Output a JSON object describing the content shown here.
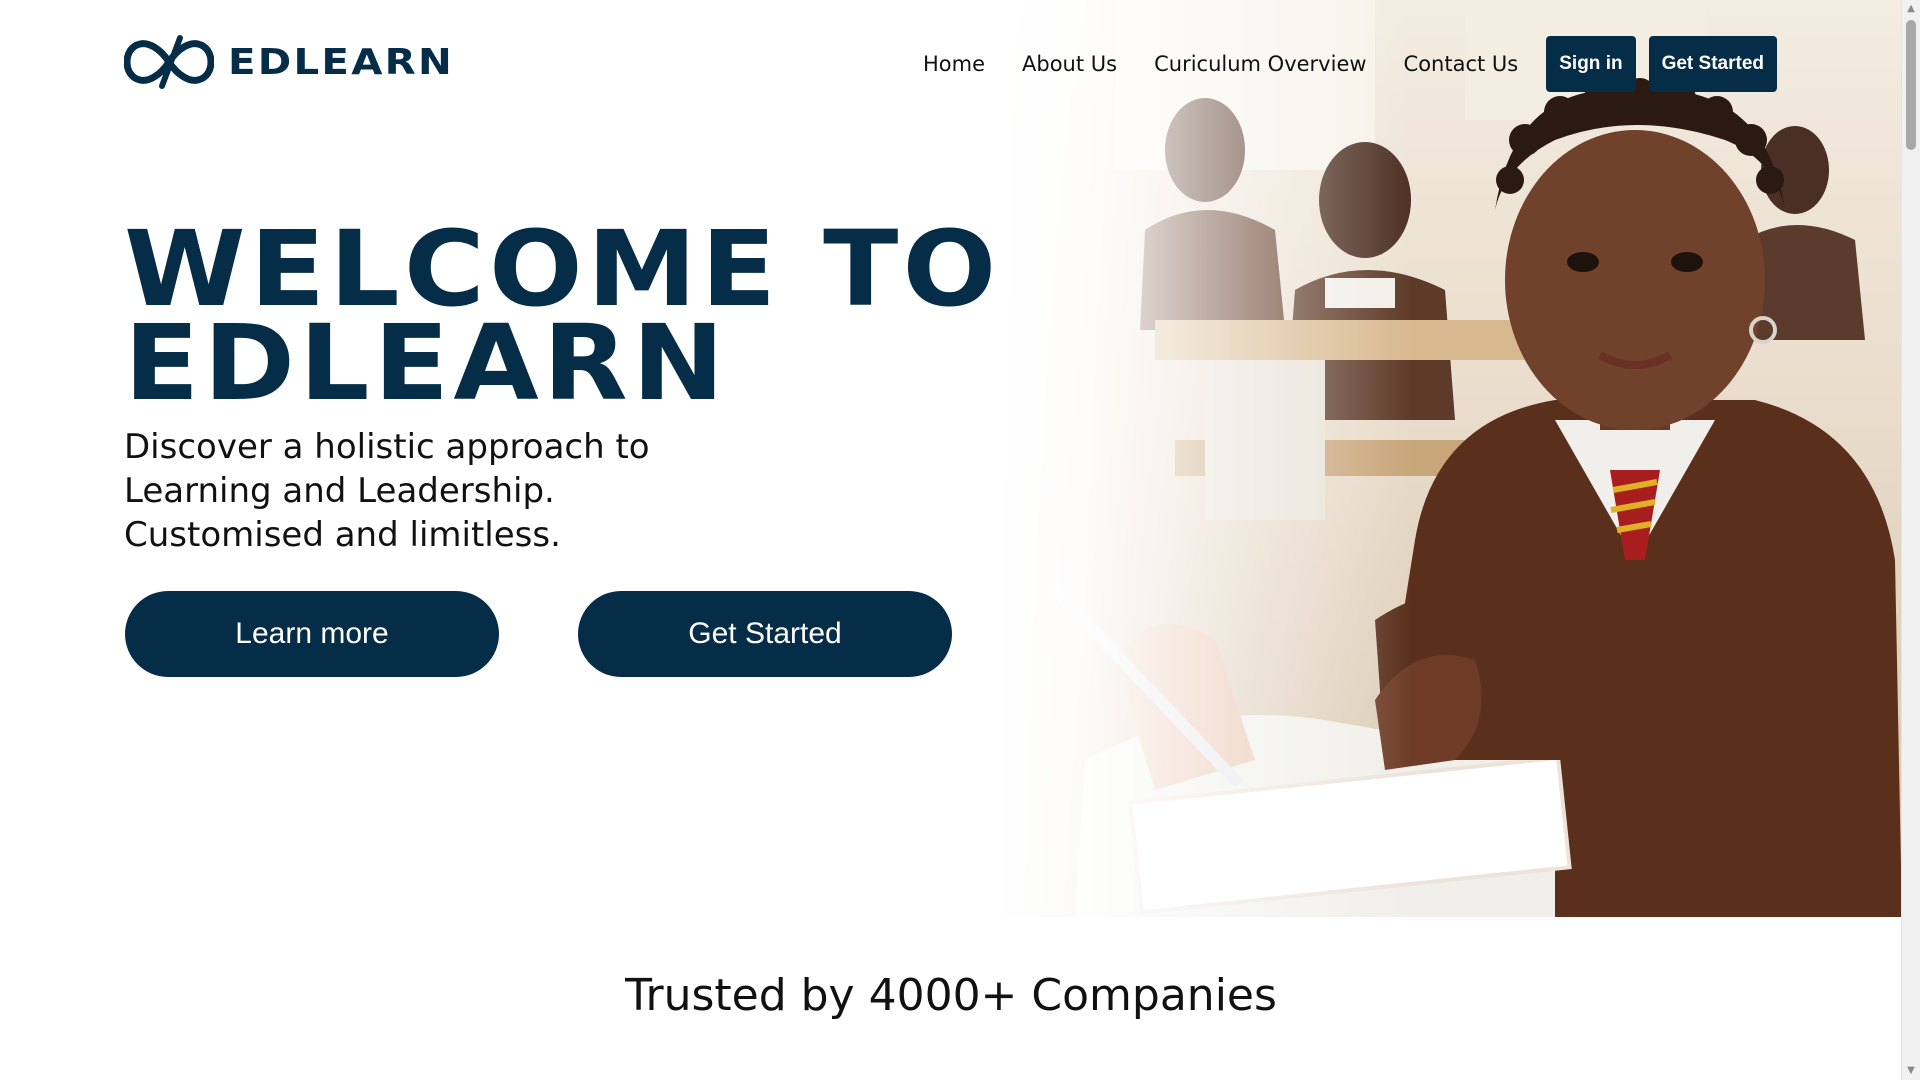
{
  "brand": {
    "name": "EDLEARN",
    "color": "#062d47"
  },
  "nav": {
    "links": [
      "Home",
      "About Us",
      "Curiculum Overview",
      "Contact Us"
    ],
    "sign_in": "Sign in",
    "get_started": "Get Started"
  },
  "hero": {
    "title_line1": "WELCOME TO",
    "title_line2": "EDLEARN",
    "subtitle_lines": [
      "Discover a holistic approach to",
      "Learning and Leadership.",
      "Customised and limitless."
    ],
    "learn_more": "Learn more",
    "get_started": "Get Started",
    "image_icon": "classroom-student-photo"
  },
  "trusted": {
    "text": "Trusted by 4000+ Companies"
  },
  "scrollbar": {
    "up_icon": "▲",
    "down_icon": "▼"
  }
}
